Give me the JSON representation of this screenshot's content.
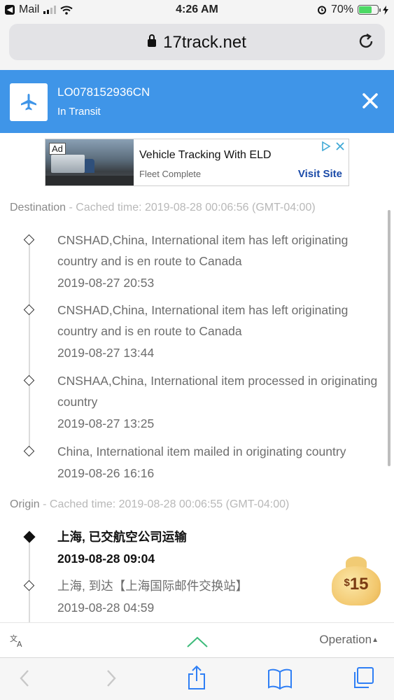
{
  "status_bar": {
    "back_app": "Mail",
    "time": "4:26 AM",
    "battery": "70%",
    "battery_level": 0.7
  },
  "browser": {
    "url": "17track.net"
  },
  "header": {
    "tracking_number": "LO078152936CN",
    "status": "In Transit",
    "icon": "airplane-icon"
  },
  "ad": {
    "label": "Ad",
    "title": "Vehicle Tracking With ELD",
    "advertiser": "Fleet Complete",
    "cta": "Visit Site"
  },
  "destination": {
    "title": "Destination",
    "cached": " - Cached time: 2019-08-28 00:06:56 (GMT-04:00)",
    "events": [
      {
        "text": "CNSHAD,China, International item has left originating country and is en route to Canada",
        "date": "2019-08-27 20:53"
      },
      {
        "text": "CNSHAD,China, International item has left originating country and is en route to Canada",
        "date": "2019-08-27 13:44"
      },
      {
        "text": "CNSHAA,China, International item processed in originating country",
        "date": "2019-08-27 13:25"
      },
      {
        "text": "China, International item mailed in originating country",
        "date": "2019-08-26 16:16"
      }
    ]
  },
  "origin": {
    "title": "Origin",
    "cached": " - Cached time: 2019-08-28 00:06:55 (GMT-04:00)",
    "events": [
      {
        "text": "上海, 已交航空公司运输",
        "date": "2019-08-28 09:04"
      },
      {
        "text": "上海, 到达【上海国际邮件交换站】",
        "date": "2019-08-28 04:59"
      }
    ]
  },
  "reward": {
    "currency": "$",
    "amount": "15"
  },
  "operation_bar": {
    "label": "Operation"
  },
  "colors": {
    "header_blue": "#3f95e8",
    "ad_cta": "#1a4aa8",
    "toolbar_icon": "#2f7ff5"
  }
}
